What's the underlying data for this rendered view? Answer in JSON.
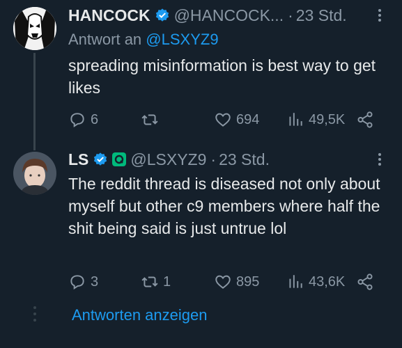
{
  "tweets": [
    {
      "name": "HANCOCK",
      "handle": "@HANCOCK...",
      "separator": "·",
      "time": "23 Std.",
      "reply_prefix": "Antwort an",
      "reply_mention": "@LSXYZ9",
      "text": "spreading misinformation is best way to get likes",
      "actions": {
        "reply_count": "6",
        "retweet_count": "",
        "like_count": "694",
        "views_count": "49,5K"
      }
    },
    {
      "name": "LS",
      "handle": "@LSXYZ9",
      "separator": "·",
      "time": "23 Std.",
      "text": "The reddit thread is diseased not only about myself but other c9 members where half the shit being said is just untrue lol",
      "actions": {
        "reply_count": "3",
        "retweet_count": "1",
        "like_count": "895",
        "views_count": "43,6K"
      }
    }
  ],
  "show_replies_label": "Antworten anzeigen",
  "colors": {
    "background": "#15202b",
    "text": "#e7e9ea",
    "muted": "#8b98a5",
    "accent": "#1d9bf0",
    "verified": "#1d9bf0"
  },
  "icons": {
    "reply": "speech-bubble-icon",
    "retweet": "retweet-arrows-icon",
    "like": "heart-icon",
    "views": "bar-chart-icon",
    "share": "share-nodes-icon",
    "more": "vertical-dots-icon",
    "verified": "verified-badge-icon"
  }
}
